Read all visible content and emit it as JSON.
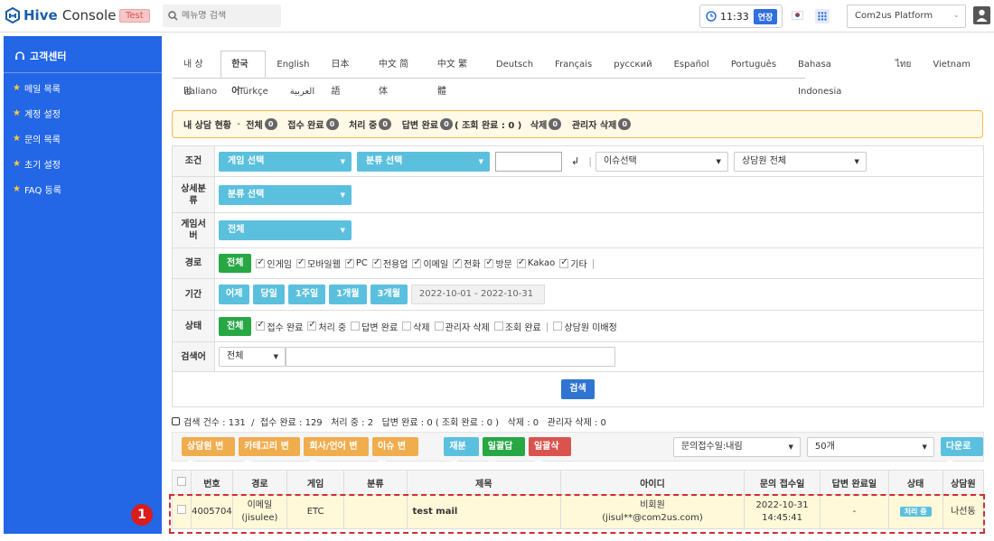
{
  "header": {
    "logo_text": "Hive",
    "logo_suffix": "Console",
    "env_badge": "Test",
    "menu_search_placeholder": "메뉴명 검색",
    "timer": "11:33",
    "extend_label": "연장",
    "platform": "Com2us Platform"
  },
  "sidebar": {
    "section_title": "고객센터",
    "items": [
      {
        "label": "메일 목록"
      },
      {
        "label": "계정 설정"
      },
      {
        "label": "문의 목록"
      },
      {
        "label": "초기 설정"
      },
      {
        "label": "FAQ 등록"
      }
    ]
  },
  "tabs": {
    "row1": [
      "내 상담",
      "한국어",
      "English",
      "日本語",
      "中文 简体",
      "中文 繁體",
      "Deutsch",
      "Français",
      "русский",
      "Español",
      "Português",
      "Bahasa Indonesia",
      "ไทย",
      "Vietnam"
    ],
    "row2": [
      "Italiano",
      "Türkçe",
      "العربية"
    ],
    "active": "한국어"
  },
  "status": {
    "title": "내 상담 현황",
    "dash": "-",
    "all_label": "전체",
    "all_count": "0",
    "received_label": "접수 완료",
    "received_count": "0",
    "processing_label": "처리 중",
    "processing_count": "0",
    "answered_label": "답변 완료",
    "answered_count": "0",
    "viewed_note": "( 조회 완료 : 0 )",
    "deleted_label": "삭제",
    "deleted_count": "0",
    "admin_deleted_label": "관리자 삭제",
    "admin_deleted_count": "0"
  },
  "filters": {
    "condition_label": "조건",
    "game_select": "게임 선택",
    "category_select": "분류 선택",
    "enter_icon": "↲",
    "issue_select": "이슈선택",
    "agent_select": "상담원 전체",
    "detail_label": "상세분류",
    "detail_select": "분류 선택",
    "server_label": "게임서버",
    "server_select": "전체",
    "route_label": "경로",
    "route_all": "전체",
    "routes": [
      "인게임",
      "모바일웹",
      "PC",
      "전용업",
      "이메일",
      "전화",
      "방문",
      "Kakao",
      "기타"
    ],
    "period_label": "기간",
    "periods": [
      "어제",
      "당일",
      "1주일",
      "1개월",
      "3개월"
    ],
    "date_range": "2022-10-01 - 2022-10-31",
    "state_label": "상태",
    "state_all": "전체",
    "states": [
      {
        "label": "접수 완료",
        "checked": true
      },
      {
        "label": "처리 중",
        "checked": true
      },
      {
        "label": "답변 완료",
        "checked": false
      },
      {
        "label": "삭제",
        "checked": false
      },
      {
        "label": "관리자 삭제",
        "checked": false
      },
      {
        "label": "조회 완료",
        "checked": false
      }
    ],
    "unassigned_label": "상담원 미배정",
    "keyword_label": "검색어",
    "keyword_select": "전체",
    "search_button": "검색"
  },
  "summary": "검색 건수 : 131  /  접수 완료 : 129   처리 중 : 2   답변 완료 : 0 ( 조회 완료 : 0 )   삭제 : 0   관리자 삭제 : 0",
  "toolbar": {
    "change_agent": "상담원 변경",
    "change_category": "카테고리 변경",
    "change_company": "회사/언어 변경",
    "change_issue": "이슈 변경",
    "reassign": "재분배",
    "bulk_answer": "일괄답변",
    "bulk_delete": "일괄삭제",
    "sort_select": "문의접수일:내림",
    "page_size": "50개",
    "download": "다운로드"
  },
  "table": {
    "headers": [
      "번호",
      "경로",
      "게임",
      "분류",
      "제목",
      "아이디",
      "문의 접수일",
      "답변 완료일",
      "상태",
      "상담원"
    ],
    "rows": [
      {
        "no": "4005704",
        "route_line1": "이메일",
        "route_line2": "(jisulee)",
        "game": "ETC",
        "category": "",
        "title": "test mail",
        "id_line1": "비회원",
        "id_line2": "(jisul**@com2us.com)",
        "received_date": "2022-10-31",
        "received_time": "14:45:41",
        "answered": "-",
        "state": "처리 중",
        "agent": "나선동"
      }
    ]
  },
  "annotation": {
    "marker": "1"
  },
  "colors": {
    "brand": "#2366e6",
    "blue_button": "#5bc0de",
    "green": "#28a745",
    "orange": "#f0ad4e",
    "red": "#d9534f",
    "highlight": "#fff9d9",
    "dash": "#d02f2f"
  }
}
